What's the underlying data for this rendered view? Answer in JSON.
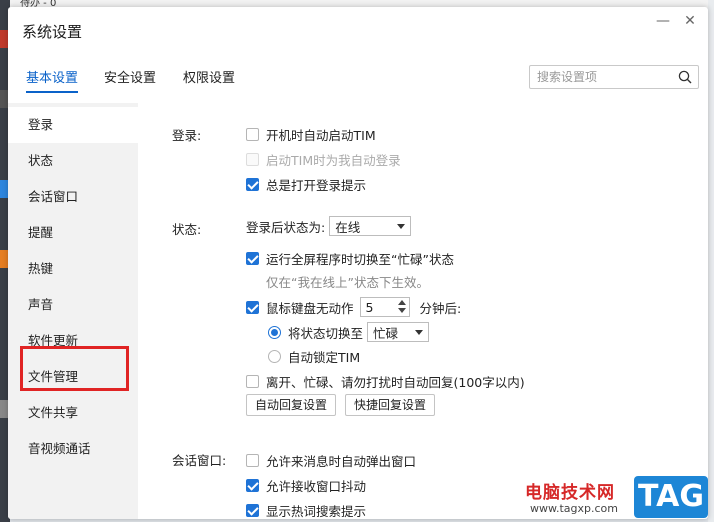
{
  "background": {
    "top_text": "待办 - 0"
  },
  "window": {
    "title": "系统设置",
    "minimize_glyph": "—",
    "close_glyph": "✕"
  },
  "tabs": [
    {
      "label": "基本设置",
      "active": true
    },
    {
      "label": "安全设置",
      "active": false
    },
    {
      "label": "权限设置",
      "active": false
    }
  ],
  "search": {
    "placeholder": "搜索设置项",
    "value": "",
    "icon": "search-icon"
  },
  "sidebar": {
    "items": [
      {
        "label": "登录",
        "active": true
      },
      {
        "label": "状态",
        "active": false
      },
      {
        "label": "会话窗口",
        "active": false
      },
      {
        "label": "提醒",
        "active": false
      },
      {
        "label": "热键",
        "active": false
      },
      {
        "label": "声音",
        "active": false
      },
      {
        "label": "软件更新",
        "active": false
      },
      {
        "label": "文件管理",
        "active": false
      },
      {
        "label": "文件共享",
        "active": false
      },
      {
        "label": "音视频通话",
        "active": false
      }
    ],
    "highlighted_item": "文件管理"
  },
  "login": {
    "label": "登录:",
    "options": [
      {
        "label": "开机时自动启动TIM",
        "checked": false,
        "disabled": false
      },
      {
        "label": "启动TIM时为我自动登录",
        "checked": false,
        "disabled": true
      },
      {
        "label": "总是打开登录提示",
        "checked": true,
        "disabled": false
      }
    ]
  },
  "status": {
    "label": "状态:",
    "after_login_label": "登录后状态为:",
    "after_login_value": "在线",
    "fullscreen_busy": {
      "label": "运行全屏程序时切换至“忙碌”状态",
      "checked": true
    },
    "fullscreen_hint": "仅在“我在线上”状态下生效。",
    "idle": {
      "label": "鼠标键盘无动作",
      "checked": true,
      "minutes": "5",
      "suffix": "分钟后:"
    },
    "switch_to": {
      "label": "将状态切换至",
      "selected": true,
      "value": "忙碌"
    },
    "auto_lock": {
      "label": "自动锁定TIM",
      "selected": false
    },
    "auto_reply": {
      "label": "离开、忙碌、请勿打扰时自动回复(100字以内)",
      "checked": false
    },
    "buttons": {
      "auto_reply_settings": "自动回复设置",
      "quick_reply_settings": "快捷回复设置"
    }
  },
  "chat_window": {
    "label": "会话窗口:",
    "options": [
      {
        "label": "允许来消息时自动弹出窗口",
        "checked": false
      },
      {
        "label": "允许接收窗口抖动",
        "checked": true
      },
      {
        "label": "显示热词搜索提示",
        "checked": true
      }
    ]
  },
  "watermark": {
    "brand": "电脑技术网",
    "url": "www.tagxp.com",
    "tag": "TAG"
  },
  "colors": {
    "accent": "#0a62c9",
    "checkbox": "#1f73d6",
    "highlight_box": "#e02424",
    "sidebar_bg": "#f2f2f2"
  }
}
